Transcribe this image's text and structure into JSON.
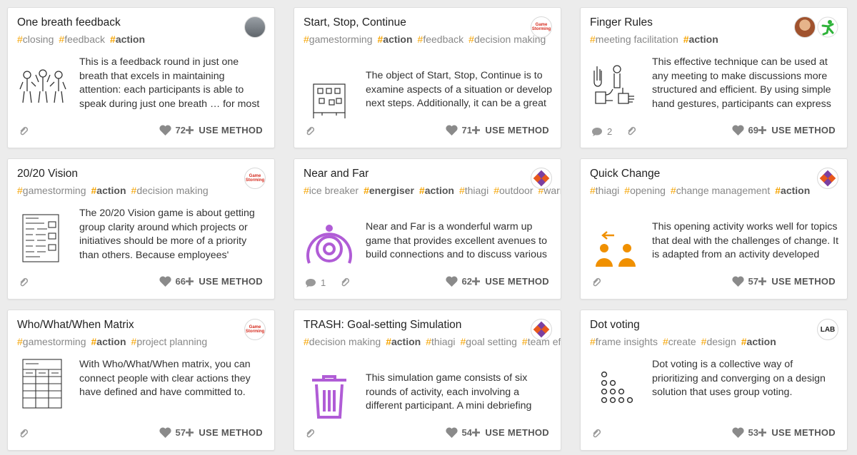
{
  "use_method_label": "USE METHOD",
  "cards": [
    {
      "title": "One breath feedback",
      "tags": [
        "closing",
        "feedback",
        "action"
      ],
      "description": "This is a feedback round in just one breath that excels in maintaining attention: each participants is able to speak during just one breath … for most",
      "likes": "72",
      "comments": null
    },
    {
      "title": "Start, Stop, Continue",
      "tags": [
        "gamestorming",
        "action",
        "feedback",
        "decision making"
      ],
      "description": "The object of Start, Stop, Continue is to examine aspects of a situation or develop next steps. Additionally, it can be a great",
      "likes": "71",
      "comments": null
    },
    {
      "title": "Finger Rules",
      "tags": [
        "meeting facilitation",
        "action"
      ],
      "description": "This effective technique can be used at any meeting to make discussions more structured and efficient. By using simple hand gestures, participants can express",
      "likes": "69",
      "comments": "2"
    },
    {
      "title": "20/20 Vision",
      "tags": [
        "gamestorming",
        "action",
        "decision making"
      ],
      "description": "The 20/20 Vision game is about getting group clarity around which projects or initiatives should be more of a priority than others. Because employees' attention",
      "likes": "66",
      "comments": null
    },
    {
      "title": "Near and Far",
      "tags": [
        "ice breaker",
        "energiser",
        "action",
        "thiagi",
        "outdoor",
        "warm up"
      ],
      "description": "Near and Far is a wonderful warm up game that provides excellent avenues to build connections and to discuss various",
      "likes": "62",
      "comments": "1"
    },
    {
      "title": "Quick Change",
      "tags": [
        "thiagi",
        "opening",
        "change management",
        "action"
      ],
      "description": "This opening activity works well for topics that deal with the challenges of change. It is adapted from an activity developed",
      "likes": "57",
      "comments": null
    },
    {
      "title": "Who/What/When Matrix",
      "tags": [
        "gamestorming",
        "action",
        "project planning"
      ],
      "description": "With Who/What/When matrix, you can connect people with clear actions they have defined and have committed to.",
      "likes": "57",
      "comments": null
    },
    {
      "title": "TRASH: Goal-setting Simulation",
      "tags": [
        "decision making",
        "action",
        "thiagi",
        "goal setting",
        "team effectiveness"
      ],
      "description": "This simulation game consists of six rounds of activity, each involving a different participant. A mini debriefing",
      "likes": "54",
      "comments": null
    },
    {
      "title": "Dot voting",
      "tags": [
        "frame insights",
        "create",
        "design",
        "action"
      ],
      "description": "Dot voting is a collective way of prioritizing and converging on a design solution that uses group voting.",
      "likes": "53",
      "comments": null
    }
  ],
  "logos": {
    "gamestorming": "Game Storming",
    "lab": "LAB"
  },
  "colors": {
    "tag_hash": "#f5a300",
    "accent_purple": "#b05cd6",
    "accent_orange": "#f09000"
  }
}
